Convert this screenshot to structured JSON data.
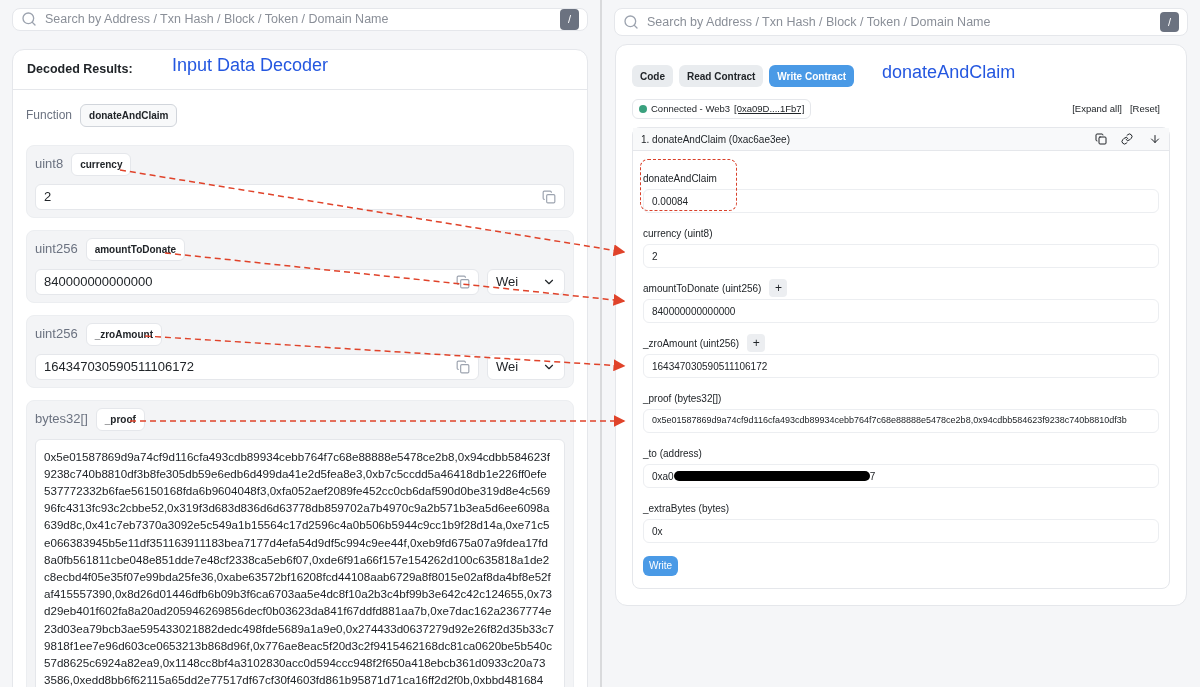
{
  "left": {
    "search": {
      "placeholder": "Search by Address / Txn Hash / Block / Token / Domain Name",
      "key": "/"
    },
    "title": "Decoded Results:",
    "annotation": "Input Data Decoder",
    "function_label": "Function",
    "function_name": "donateAndClaim",
    "params": [
      {
        "kind": "single",
        "type": "uint8",
        "name": "currency",
        "value": "2"
      },
      {
        "kind": "unit",
        "type": "uint256",
        "name": "amountToDonate",
        "value": "840000000000000",
        "unit": "Wei"
      },
      {
        "kind": "unit",
        "type": "uint256",
        "name": "_zroAmount",
        "value": "164347030590511106172",
        "unit": "Wei"
      },
      {
        "kind": "multiline",
        "type": "bytes32[]",
        "name": "_proof",
        "lines": [
          "0x5e01587869d9a74cf9d116cfa493cdb89934cebb764f7c68e88888e5478ce2b8,0x94cdbb584623f",
          "9238c740b8810df3b8fe305db59e6edb6d499da41e2d5fea8e3,0xb7c5ccdd5a46418db1e226ff0efe",
          "537772332b6fae56150168fda6b9604048f3,0xfa052aef2089fe452cc0cb6daf590d0be319d8e4c569",
          "96fc4313fc93c2cbbe52,0x319f3d683d836d6d63778db859702a7b4970c9a2b571b3ea5d6ee6098a",
          "639d8c,0x41c7eb7370a3092e5c549a1b15564c17d2596c4a0b506b5944c9cc1b9f28d14a,0xe71c5",
          "e066383945b5e11df351163911183bea7177d4efa54d9df5c994c9ee44f,0xeb9fd675a07a9fdea17fd",
          "8a0fb561811cbe048e851dde7e48cf2338ca5eb6f07,0xde6f91a66f157e154262d100c635818a1de2",
          "c8ecbd4f05e35f07e99bda25fe36,0xabe63572bf16208fcd44108aab6729a8f8015e02af8da4bf8e52f",
          "af415557390,0x8d26d01446dfb6b09b3f6ca6703aa5e4dc8f10a2b3c4bf99b3e642c42c124655,0x73",
          "d29eb401f602fa8a20ad205946269856decf0b03623da841f67ddfd881aa7b,0xe7dac162a2367774e",
          "23d03ea79bcb3ae595433021882dedc498fde5689a1a9e0,0x274433d0637279d92e26f82d35b33c7",
          "9818f1ee7e96d603ce0653213b868d96f,0x776ae8eac5f20d3c2f9415462168dc81ca0620be5b540c",
          "57d8625c6924a82ea9,0x1148cc8bf4a3102830acc0d594ccc948f2f650a418ebcb361d0933c20a73",
          "3586,0xedd8bb6f62115a65dd2e77517df67cf30f4603fd861b95871d71ca16ff2d2f0b,0xbbd481684"
        ]
      }
    ]
  },
  "right": {
    "search": {
      "placeholder": "Search by Address / Txn Hash / Block / Token / Domain Name",
      "key": "/"
    },
    "tabs": [
      {
        "label": "Code",
        "selected": false
      },
      {
        "label": "Read Contract",
        "selected": false
      },
      {
        "label": "Write Contract",
        "selected": true
      }
    ],
    "annotation": "donateAndClaim",
    "connection": {
      "connected": true,
      "status": "Connected - Web3",
      "address": "[0xa09D....1Fb7]"
    },
    "actions": [
      "[Expand all]",
      "[Reset]"
    ],
    "method": {
      "title": "1. donateAndClaim (0xac6ae3ee)",
      "fields": [
        {
          "kind": "text",
          "label": "donateAndClaim",
          "value": "0.00084",
          "highlighted": true,
          "add_button": false
        },
        {
          "kind": "text",
          "label": "currency (uint8)",
          "value": "2",
          "highlighted": false,
          "add_button": false
        },
        {
          "kind": "text",
          "label": "amountToDonate (uint256)",
          "value": "840000000000000",
          "highlighted": false,
          "add_button": true,
          "add_label": "+"
        },
        {
          "kind": "text",
          "label": "_zroAmount (uint256)",
          "value": "164347030590511106172",
          "highlighted": false,
          "add_button": true,
          "add_label": "+"
        },
        {
          "kind": "text",
          "label": "_proof (bytes32[])",
          "value": "0x5e01587869d9a74cf9d116cfa493cdb89934cebb764f7c68e88888e5478ce2b8,0x94cdbb584623f9238c740b8810df3b",
          "highlighted": false,
          "add_button": false
        },
        {
          "kind": "redacted",
          "label": "_to (address)",
          "value_start": "0xa0",
          "value_end": "7",
          "highlighted": false,
          "add_button": false
        },
        {
          "kind": "text",
          "label": "_extraBytes (bytes)",
          "value": "0x",
          "highlighted": false,
          "add_button": false
        }
      ],
      "write_button": "Write"
    }
  }
}
